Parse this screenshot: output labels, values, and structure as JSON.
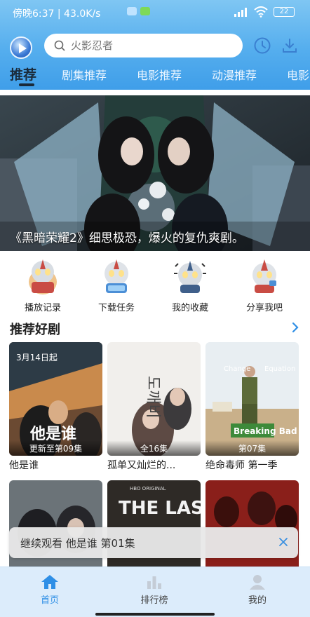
{
  "status": {
    "time": "傍晚6:37 | 43.0K/s",
    "battery": "22"
  },
  "search": {
    "placeholder": "火影忍者"
  },
  "tabs": [
    {
      "label": "推荐"
    },
    {
      "label": "剧集推荐"
    },
    {
      "label": "电影推荐"
    },
    {
      "label": "动漫推荐"
    },
    {
      "label": "电影"
    }
  ],
  "banner": {
    "caption": "《黑暗荣耀2》细思极恐，爆火的复仇爽剧。"
  },
  "quick": [
    {
      "label": "播放记录"
    },
    {
      "label": "下载任务"
    },
    {
      "label": "我的收藏"
    },
    {
      "label": "分享我吧"
    }
  ],
  "section": {
    "title": "推荐好剧"
  },
  "cards": [
    {
      "title": "他是谁",
      "badge": "更新至第09集",
      "poster_text": "他是谁",
      "poster_date": "3月14日起"
    },
    {
      "title": "孤单又灿烂的...",
      "badge": "全16集",
      "poster_text": "도깨비"
    },
    {
      "title": "绝命毒师 第一季",
      "badge": "第07集",
      "poster_text": "Breaking Bad",
      "poster_sub": "Change",
      "poster_sub2": "Equation"
    },
    {
      "title": "",
      "badge": ""
    },
    {
      "title": "",
      "badge": "",
      "poster_text": "THE LAST",
      "poster_sub": "HBO ORIGINAL"
    },
    {
      "title": "",
      "badge": ""
    }
  ],
  "resume": {
    "text": "继续观看 他是谁 第01集"
  },
  "nav": [
    {
      "label": "首页"
    },
    {
      "label": "排行榜"
    },
    {
      "label": "我的"
    }
  ],
  "colors": {
    "header_top": "#7fc6f3",
    "header_bottom": "#3f9ee9",
    "accent": "#2f8fe6",
    "nav_bg": "#dcecfb"
  }
}
